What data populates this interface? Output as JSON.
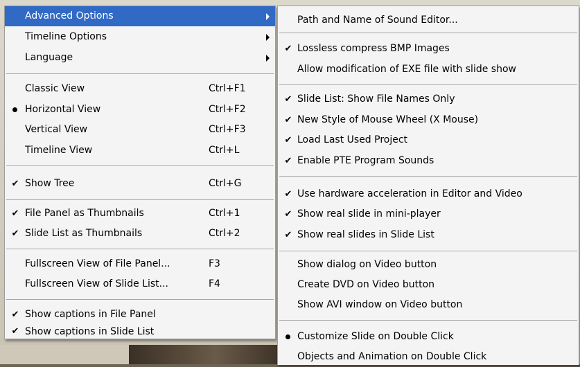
{
  "main_menu": {
    "items": [
      {
        "label": "Advanced Options",
        "submenu": true
      },
      {
        "label": "Timeline Options",
        "submenu": true
      },
      {
        "label": "Language",
        "submenu": true
      },
      {
        "label": "Classic View",
        "shortcut": "Ctrl+F1"
      },
      {
        "label": "Horizontal View",
        "shortcut": "Ctrl+F2",
        "state": "radio"
      },
      {
        "label": "Vertical View",
        "shortcut": "Ctrl+F3"
      },
      {
        "label": "Timeline View",
        "shortcut": "Ctrl+L"
      },
      {
        "label": "Show Tree",
        "shortcut": "Ctrl+G",
        "state": "checked"
      },
      {
        "label": "File Panel as Thumbnails",
        "shortcut": "Ctrl+1",
        "state": "checked"
      },
      {
        "label": "Slide List as Thumbnails",
        "shortcut": "Ctrl+2",
        "state": "checked"
      },
      {
        "label": "Fullscreen View of File Panel...",
        "shortcut": "F3"
      },
      {
        "label": "Fullscreen View of Slide List...",
        "shortcut": "F4"
      },
      {
        "label": "Show captions in File Panel",
        "state": "checked"
      },
      {
        "label": "Show captions in Slide List",
        "state": "checked"
      }
    ]
  },
  "sub_menu": {
    "items": [
      {
        "label": "Path and Name of Sound Editor..."
      },
      {
        "label": "Lossless compress BMP Images",
        "state": "checked"
      },
      {
        "label": "Allow modification of EXE file with slide show"
      },
      {
        "label": "Slide List: Show File Names Only",
        "state": "checked"
      },
      {
        "label": "New Style of Mouse Wheel (X Mouse)",
        "state": "checked"
      },
      {
        "label": "Load Last Used Project",
        "state": "checked"
      },
      {
        "label": "Enable PTE Program Sounds",
        "state": "checked"
      },
      {
        "label": "Use hardware acceleration in Editor and Video",
        "state": "checked"
      },
      {
        "label": "Show real slide in mini-player",
        "state": "checked"
      },
      {
        "label": "Show real slides in Slide List",
        "state": "checked"
      },
      {
        "label": "Show dialog on Video button"
      },
      {
        "label": "Create DVD on Video button"
      },
      {
        "label": "Show AVI window on Video button"
      },
      {
        "label": "Customize Slide on Double Click",
        "state": "radio"
      },
      {
        "label": "Objects and Animation on Double Click"
      }
    ]
  },
  "glyphs": {
    "check": "✔"
  },
  "colors": {
    "highlight": "#316ac5",
    "menu_bg": "#f4f4f4",
    "separator": "#a6a6a6"
  }
}
